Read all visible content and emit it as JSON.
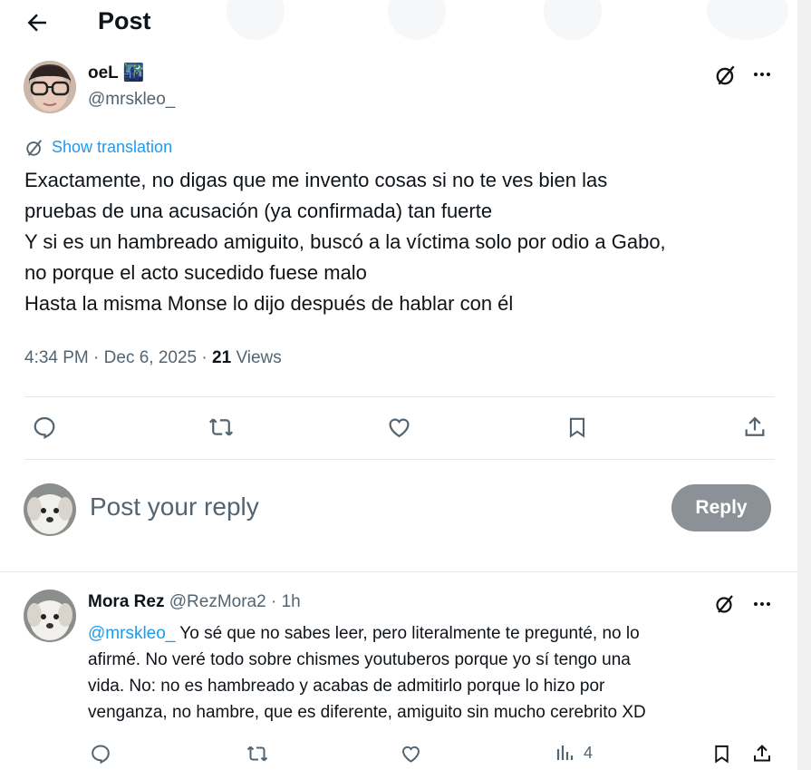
{
  "header": {
    "title": "Post"
  },
  "post": {
    "author_name": "oeL 🌃",
    "author_handle": "@mrskleo_",
    "show_translation": "Show translation",
    "lines": [
      "Exactamente, no digas que me invento cosas si no te ves bien las",
      "pruebas de una acusación (ya confirmada) tan fuerte",
      "Y si es un hambreado amiguito, buscó a la víctima solo por odio a Gabo,",
      "no porque el acto sucedido fuese malo",
      "Hasta la misma Monse lo dijo después de hablar con él"
    ],
    "time": "4:34 PM",
    "date": "Dec 6, 2025",
    "views_count": "21",
    "views_label": "Views"
  },
  "composer": {
    "placeholder": "Post your reply",
    "button": "Reply"
  },
  "reply": {
    "author_name": "Mora Rez",
    "author_handle": "@RezMora2",
    "time": "1h",
    "mention": "@mrskleo_",
    "line1_rest": " Yo sé que no sabes leer, pero literalmente te pregunté, no lo",
    "line2": "afirmé.  No veré todo sobre chismes youtuberos porque yo sí tengo una",
    "line3": "vida. No: no es hambreado y acabas de admitirlo porque lo hizo por",
    "line4": "venganza, no hambre,  que es diferente, amiguito sin mucho cerebrito XD",
    "views_count": "4"
  },
  "icons": [
    "back-arrow-icon",
    "grok-icon",
    "more-icon",
    "translate-icon",
    "reply-icon",
    "repost-icon",
    "like-icon",
    "bookmark-icon",
    "share-icon",
    "views-icon"
  ]
}
